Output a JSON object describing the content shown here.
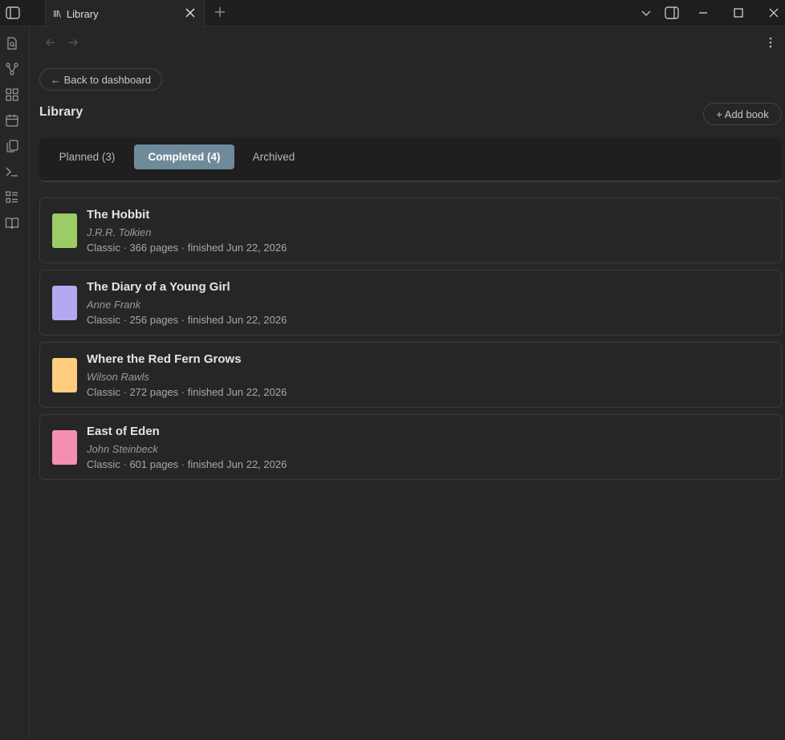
{
  "window": {
    "tab_icon": "lll\\",
    "tab_label": "Library"
  },
  "nav": {
    "back_label": "← Back to dashboard"
  },
  "page": {
    "title": "Library",
    "add_label": "+ Add book"
  },
  "tabs": [
    {
      "label": "Planned (3)",
      "active": false
    },
    {
      "label": "Completed (4)",
      "active": true
    },
    {
      "label": "Archived",
      "active": false
    }
  ],
  "books": [
    {
      "title": "The Hobbit",
      "author": "J.R.R. Tolkien",
      "meta": "Classic · 366 pages · finished Jun 22, 2026",
      "color": "#9ccc65"
    },
    {
      "title": "The Diary of a Young Girl",
      "author": "Anne Frank",
      "meta": "Classic · 256 pages · finished Jun 22, 2026",
      "color": "#b3a9f0"
    },
    {
      "title": "Where the Red Fern Grows",
      "author": "Wilson Rawls",
      "meta": "Classic · 272 pages · finished Jun 22, 2026",
      "color": "#ffcc80"
    },
    {
      "title": "East of Eden",
      "author": "John Steinbeck",
      "meta": "Classic · 601 pages · finished Jun 22, 2026",
      "color": "#f48fb1"
    }
  ],
  "ribbon_icons": [
    "file-search-icon",
    "graph-icon",
    "grid-icon",
    "calendar-icon",
    "copy-icon",
    "terminal-icon",
    "list-icon",
    "book-open-icon"
  ],
  "colors": {
    "accent_tab": "#6f8a9a",
    "background": "#262626"
  }
}
